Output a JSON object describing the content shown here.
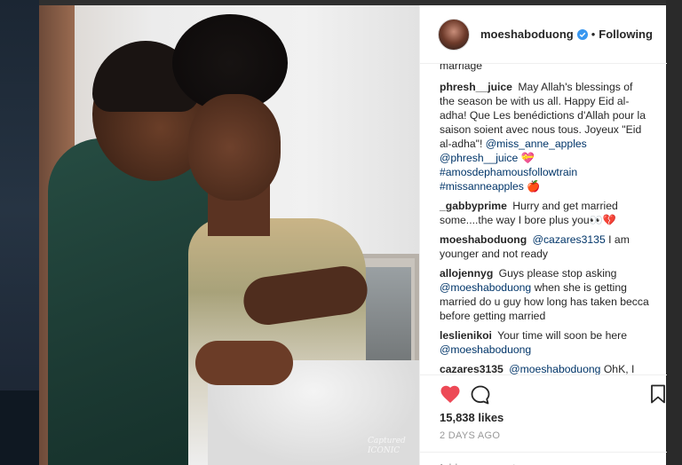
{
  "photo": {
    "watermark": "Captured ICONIC"
  },
  "header": {
    "username": "moeshaboduong",
    "follow_status": "Following",
    "separator": "•"
  },
  "comments": [
    {
      "user": "",
      "text": "marriage",
      "partial": true
    },
    {
      "user": "phresh__juice",
      "text": "May Allah's blessings of the season be with us all. Happy Eid al-adha! Que Les benédictions d'Allah pour la saison soient avec nous tous. Joyeux \"Eid al-adha\"! ",
      "mentions": "@miss_anne_apples @phresh__juice 💝 #amosdephamousfollowtrain #missanneapples 🍎"
    },
    {
      "user": "_gabbyprime",
      "text": "Hurry and get married some....the way I bore plus you👀💔"
    },
    {
      "user": "moeshaboduong",
      "mention_lead": "@cazares3135",
      "text": " I am younger and not ready"
    },
    {
      "user": "allojennyg",
      "text": "Guys please stop asking ",
      "mention_mid": "@moeshaboduong",
      "text2": " when she is getting married do u guy how long has taken becca before getting married"
    },
    {
      "user": "leslienikoi",
      "text": "Your time will soon be here ",
      "mention_end": "@moeshaboduong"
    },
    {
      "user": "cazares3135",
      "mention_lead": "@moeshaboduong",
      "text": " OhK, I guess God's time is the best 👌"
    }
  ],
  "actions": {
    "likes": "15,838 likes",
    "time": "2 DAYS AGO",
    "add_comment_placeholder": "Add a comment…",
    "more": "•••"
  },
  "icons": [
    "heart-icon",
    "comment-icon",
    "bookmark-icon",
    "verified-icon"
  ],
  "colors": {
    "like": "#ed4956",
    "verified": "#3897f0",
    "mention": "#003569",
    "muted": "#999999"
  }
}
